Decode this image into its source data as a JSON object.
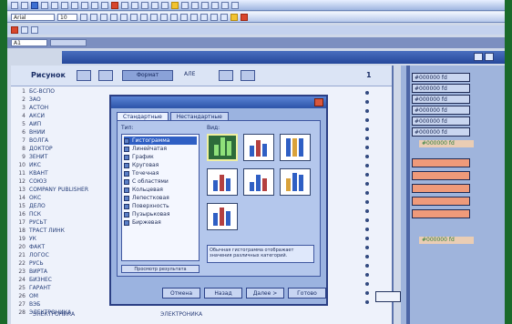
{
  "toolbar": {
    "font_name": "Arial",
    "font_size": "10",
    "name_box": "A1"
  },
  "second_window": {
    "title": ""
  },
  "sheet": {
    "header": {
      "label": "Рисунок",
      "button_label": "Формат",
      "aux_label": "АЛЕ",
      "col_label": "1"
    },
    "rows": [
      {
        "n": "1",
        "t": "БС-ВСПО"
      },
      {
        "n": "2",
        "t": "ЗАО"
      },
      {
        "n": "3",
        "t": "АСТОН"
      },
      {
        "n": "4",
        "t": "АКСИ"
      },
      {
        "n": "5",
        "t": "АИП"
      },
      {
        "n": "6",
        "t": "ВНИИ"
      },
      {
        "n": "7",
        "t": "ВОЛГА"
      },
      {
        "n": "8",
        "t": "ДОКТОР"
      },
      {
        "n": "9",
        "t": "ЗЕНИТ"
      },
      {
        "n": "10",
        "t": "ИКС"
      },
      {
        "n": "11",
        "t": "КВАНТ"
      },
      {
        "n": "12",
        "t": "СОЮЗ"
      },
      {
        "n": "13",
        "t": "COMPANY PUBLISHER"
      },
      {
        "n": "14",
        "t": "ОКС"
      },
      {
        "n": "15",
        "t": "ДЕЛО"
      },
      {
        "n": "16",
        "t": "ПСК"
      },
      {
        "n": "17",
        "t": "РУСЬТ"
      },
      {
        "n": "18",
        "t": "ТРАСТ ЛИНК"
      },
      {
        "n": "19",
        "t": "УК"
      },
      {
        "n": "20",
        "t": "ФАКТ"
      },
      {
        "n": "21",
        "t": "ЛОГОС"
      },
      {
        "n": "22",
        "t": "РУСЬ"
      },
      {
        "n": "23",
        "t": "ВИРТА"
      },
      {
        "n": "24",
        "t": "БИЗНЕС"
      },
      {
        "n": "25",
        "t": "ГАРАНТ"
      },
      {
        "n": "26",
        "t": "ОМ"
      },
      {
        "n": "27",
        "t": "ВЭБ"
      },
      {
        "n": "28",
        "t": "ЭЛЕКТРОНИКА"
      }
    ],
    "bottom_text_1": "ЭЛЕКТРОНИКА",
    "bottom_text_2": "ЭЛЕКТРОНИКА"
  },
  "right_panel": {
    "cells_top": [
      "#000000 fd",
      "#000000 fd",
      "#000000 fd",
      "#000000 fd",
      "#000000 fd",
      "#000000 fd"
    ],
    "green_note_1": "#000000 fd",
    "cells_orange": [
      "",
      "",
      "",
      "",
      ""
    ],
    "green_note_2": "#000000 fd"
  },
  "dialog": {
    "title": "",
    "tabs": [
      "Стандартные",
      "Нестандартные"
    ],
    "list_label": "Тип:",
    "gallery_label": "Вид:",
    "list_items": [
      "Гистограмма",
      "Линейчатая",
      "График",
      "Круговая",
      "Точечная",
      "С областями",
      "Кольцевая",
      "Лепестковая",
      "Поверхность",
      "Пузырьковая",
      "Биржевая"
    ],
    "description": "Обычная гистограмма отображает значения различных категорий.",
    "preview_button": "Просмотр результата",
    "buttons": [
      "Отмена",
      "Назад",
      "Далее >",
      "Готово"
    ]
  }
}
